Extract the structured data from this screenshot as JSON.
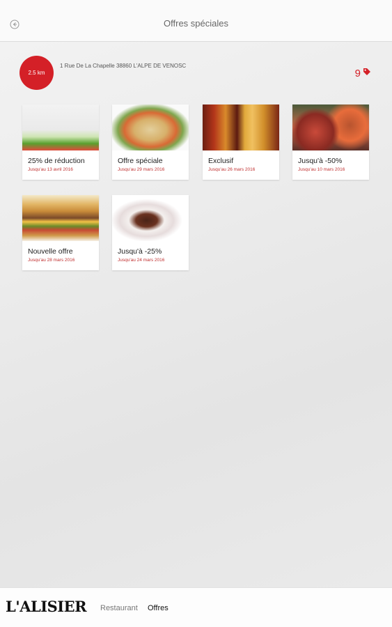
{
  "header": {
    "title": "Offres spéciales",
    "back_icon": "back-arrow-icon"
  },
  "restaurant": {
    "distance": "2.5 km",
    "address": "1 Rue De La Chapelle 38860 L'ALPE DE VENOSC",
    "offers_count": "9",
    "offers_icon": "tag-icon"
  },
  "offers": [
    {
      "title": "25% de réduction",
      "date": "Jusqu'au 13 avril 2016"
    },
    {
      "title": "Offre spéciale",
      "date": "Jusqu'au 29 mars 2016"
    },
    {
      "title": "Exclusif",
      "date": "Jusqu'au 26 mars 2016"
    },
    {
      "title": "Jusqu'à -50%",
      "date": "Jusqu'au 10 mars 2016"
    },
    {
      "title": "Nouvelle offre",
      "date": "Jusqu'au 28 mars 2016"
    },
    {
      "title": "Jusqu'à -25%",
      "date": "Jusqu'au 24 mars 2016"
    }
  ],
  "footer": {
    "brand": "L'ALISIER",
    "tabs": [
      {
        "label": "Restaurant",
        "active": false
      },
      {
        "label": "Offres",
        "active": true
      }
    ]
  },
  "colors": {
    "accent": "#d42027"
  }
}
